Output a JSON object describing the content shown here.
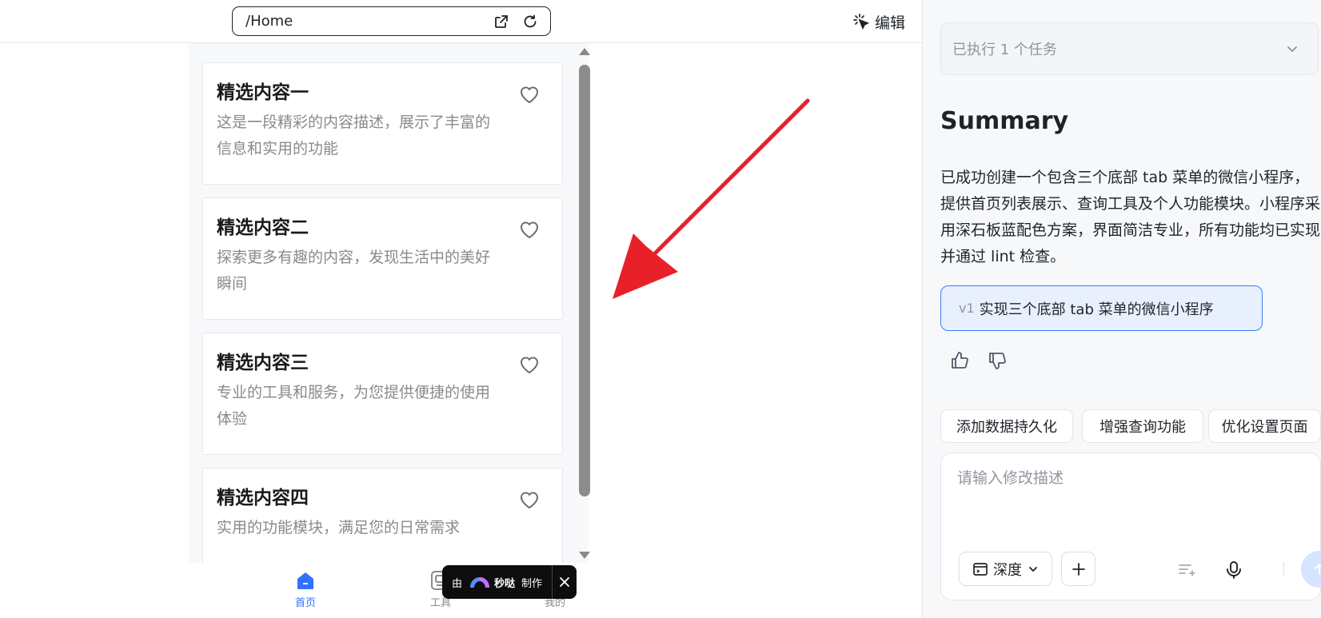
{
  "topbar": {
    "url": "/Home",
    "open_external_icon": "open-external-icon",
    "refresh_icon": "refresh-icon",
    "edit_icon": "sparkle-cursor-icon",
    "edit_label": "编辑"
  },
  "cards": [
    {
      "title": "精选内容一",
      "desc": "这是一段精彩的内容描述，展示了丰富的信息和实用的功能"
    },
    {
      "title": "精选内容二",
      "desc": "探索更多有趣的内容，发现生活中的美好瞬间"
    },
    {
      "title": "精选内容三",
      "desc": "专业的工具和服务，为您提供便捷的使用体验"
    },
    {
      "title": "精选内容四",
      "desc": "实用的功能模块，满足您的日常需求"
    }
  ],
  "tabbar": {
    "tabs": [
      {
        "label": "首页",
        "icon": "home-icon",
        "active": true
      },
      {
        "label": "工具",
        "icon": "tools-icon",
        "active": false
      },
      {
        "label": "我的",
        "icon": "user-icon",
        "active": false
      }
    ],
    "active_color": "#3370ff",
    "inactive_color": "#8a8a8a"
  },
  "badge": {
    "by": "由",
    "name": "秒哒",
    "make": "制作"
  },
  "annotation": {
    "icon": "red-arrow-icon",
    "color": "#e8202a"
  },
  "panel": {
    "task_summary": "已执行 1 个任务",
    "summary_title": "Summary",
    "summary_body": "已成功创建一个包含三个底部 tab 菜单的微信小程序，提供首页列表展示、查询工具及个人功能模块。小程序采用深石板蓝配色方案，界面简洁专业，所有功能均已实现并通过 lint 检查。",
    "version_tag": "v1",
    "version_text": "实现三个底部 tab 菜单的微信小程序",
    "suggestions": [
      "添加数据持久化",
      "增强查询功能",
      "优化设置页面"
    ],
    "input_placeholder": "请输入修改描述",
    "mode_label": "深度",
    "accent": "#3b7cff"
  }
}
